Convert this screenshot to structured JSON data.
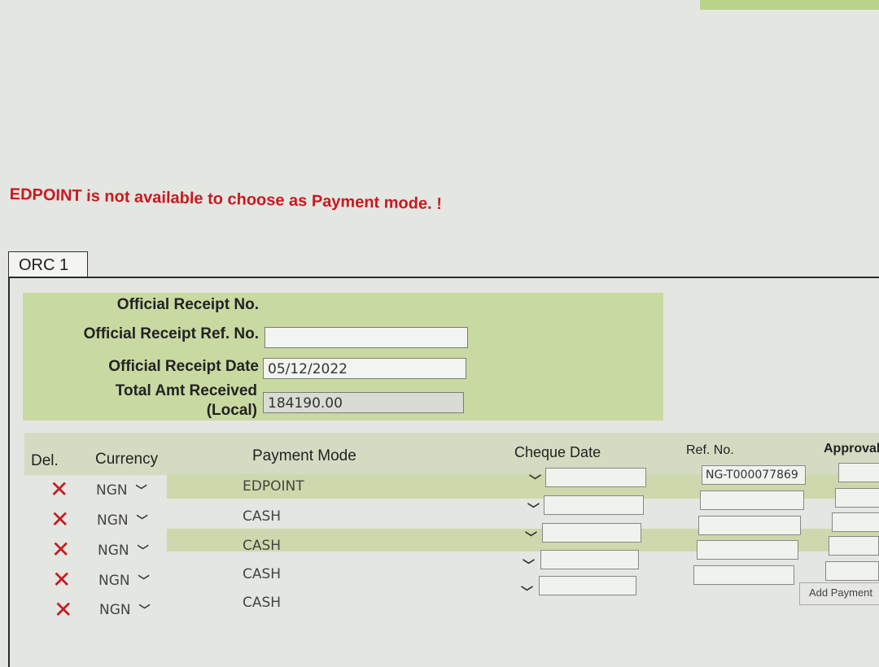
{
  "error_message": "EDPOINT is not available to choose as Payment mode. !",
  "tab": {
    "label": "ORC 1"
  },
  "form": {
    "receipt_no_label": "Official Receipt No.",
    "receipt_no_value": "",
    "ref_no_label": "Official Receipt Ref. No.",
    "ref_no_value": "",
    "date_label": "Official Receipt Date",
    "date_value": "05/12/2022",
    "total_label_line1": "Total Amt Received",
    "total_label_line2": "(Local)",
    "total_value": "184190.00"
  },
  "table": {
    "headers": {
      "del": "Del.",
      "currency": "Currency",
      "payment_mode": "Payment Mode",
      "cheque_date": "Cheque Date",
      "ref_no": "Ref. No.",
      "approval": "Approval"
    },
    "rows": [
      {
        "currency": "NGN",
        "payment_mode": "EDPOINT",
        "cheque_date": "",
        "ref_no": "NG-T000077869",
        "approval": ""
      },
      {
        "currency": "NGN",
        "payment_mode": "CASH",
        "cheque_date": "",
        "ref_no": "",
        "approval": ""
      },
      {
        "currency": "NGN",
        "payment_mode": "CASH",
        "cheque_date": "",
        "ref_no": "",
        "approval": ""
      },
      {
        "currency": "NGN",
        "payment_mode": "CASH",
        "cheque_date": "",
        "ref_no": "",
        "approval": ""
      },
      {
        "currency": "NGN",
        "payment_mode": "CASH",
        "cheque_date": "",
        "ref_no": "",
        "approval": ""
      }
    ],
    "add_button": "Add Payment"
  },
  "colors": {
    "error": "#c8191f",
    "form_bg": "#c9d9a2",
    "delete_icon": "#c8191f"
  }
}
